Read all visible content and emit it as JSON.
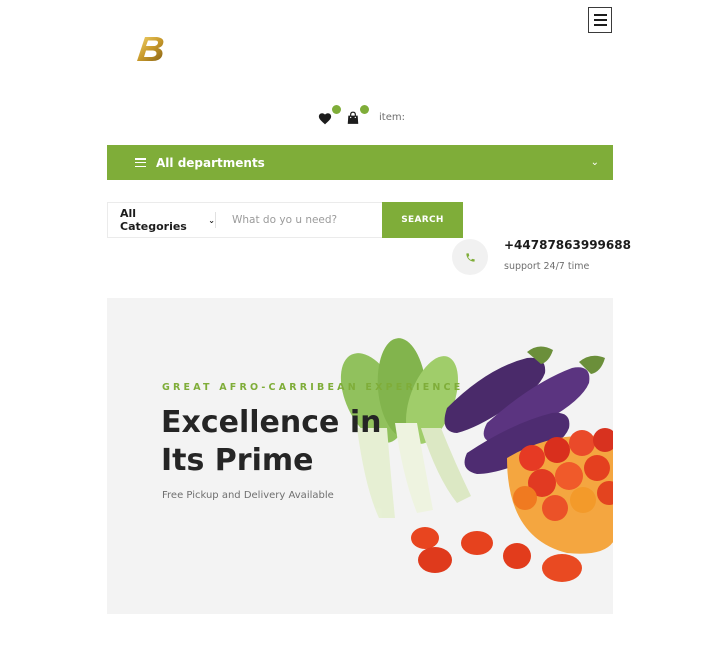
{
  "header": {
    "logo_alt": "B",
    "menu_icon": "hamburger-icon",
    "wishlist_icon": "heart-icon",
    "cart_icon": "shopping-bag-icon",
    "item_text": "item:"
  },
  "departments": {
    "label": "All departments",
    "chevron": "⌄"
  },
  "search": {
    "category_label": "All Categories",
    "placeholder": "What do yo u need?",
    "button_label": "SEARCH"
  },
  "contact": {
    "phone_icon": "phone-icon",
    "phone": "+44787863999688",
    "support": "support 24/7 time"
  },
  "hero": {
    "kicker": "GREAT AFRO-CARRIBEAN EXPERIENCE",
    "title_line1": "Excellence in",
    "title_line2": "Its Prime",
    "subtitle": "Free Pickup and Delivery Available"
  },
  "colors": {
    "accent": "#7fad39",
    "hero_bg": "#f3f3f3"
  }
}
